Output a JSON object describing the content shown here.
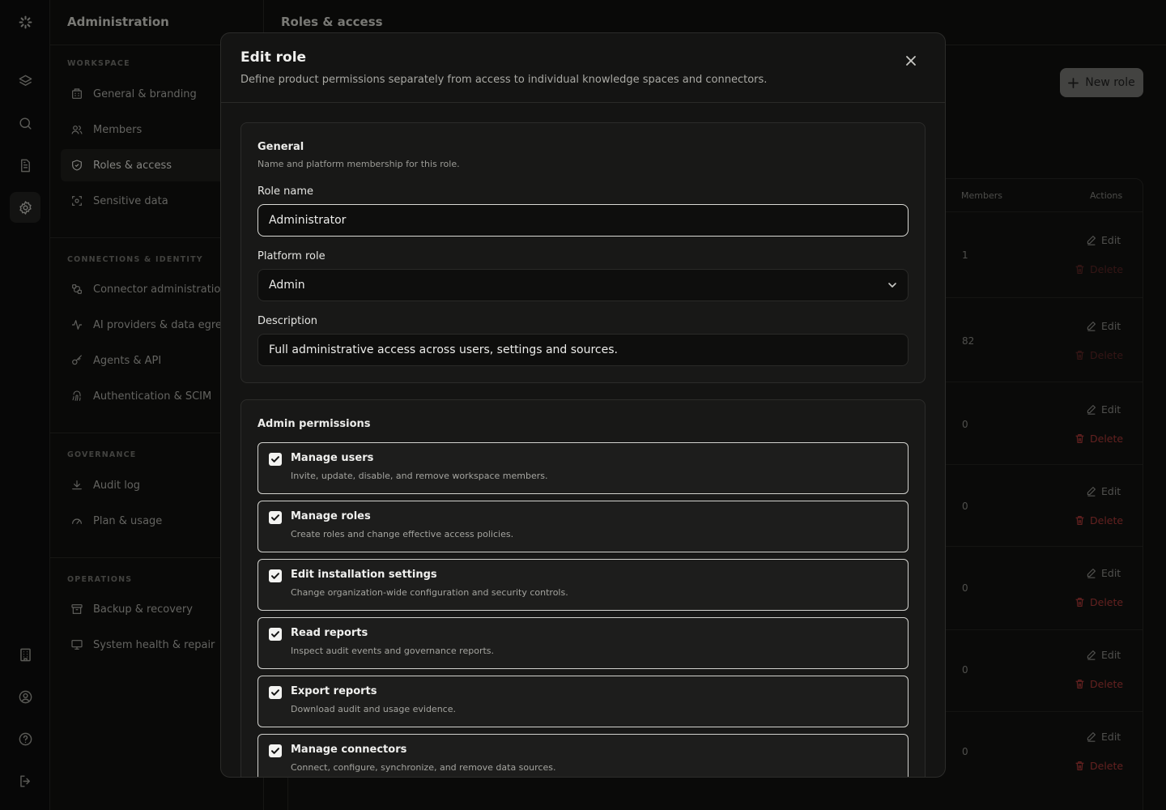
{
  "sidebar": {
    "title": "Administration",
    "sections": {
      "workspace": "WORKSPACE",
      "connections": "CONNECTIONS & IDENTITY",
      "governance": "GOVERNANCE",
      "operations": "OPERATIONS"
    },
    "items": {
      "general": "General & branding",
      "members": "Members",
      "roles": "Roles & access",
      "sensitive": "Sensitive data",
      "connector": "Connector administration",
      "ai": "AI providers & data egress",
      "agents": "Agents & API",
      "auth": "Authentication & SCIM",
      "audit": "Audit log",
      "plan": "Plan & usage",
      "backup": "Backup & recovery",
      "health": "System health & repair"
    }
  },
  "main": {
    "title": "Roles & access",
    "new_role_label": "New role",
    "columns": {
      "members": "Members",
      "actions": "Actions"
    },
    "rows": [
      {
        "members": "1",
        "edit": "Edit",
        "delete": "Delete"
      },
      {
        "members": "82",
        "edit": "Edit",
        "delete": "Delete"
      },
      {
        "members": "0",
        "edit": "Edit",
        "delete": "Delete"
      },
      {
        "members": "0",
        "edit": "Edit",
        "delete": "Delete"
      },
      {
        "members": "0",
        "edit": "Edit",
        "delete": "Delete"
      },
      {
        "members": "0",
        "edit": "Edit",
        "delete": "Delete"
      },
      {
        "members": "0",
        "edit": "Edit",
        "delete": "Delete"
      }
    ]
  },
  "modal": {
    "title": "Edit role",
    "subtitle": "Define product permissions separately from access to individual knowledge spaces and connectors.",
    "general": {
      "heading": "General",
      "subheading": "Name and platform membership for this role.",
      "role_name_label": "Role name",
      "role_name_value": "Administrator",
      "platform_role_label": "Platform role",
      "platform_role_value": "Admin",
      "description_label": "Description",
      "description_value": "Full administrative access across users, settings and sources."
    },
    "permissions": {
      "heading": "Admin permissions",
      "items": [
        {
          "title": "Manage users",
          "desc": "Invite, update, disable, and remove workspace members.",
          "checked": true
        },
        {
          "title": "Manage roles",
          "desc": "Create roles and change effective access policies.",
          "checked": true
        },
        {
          "title": "Edit installation settings",
          "desc": "Change organization-wide configuration and security controls.",
          "checked": true
        },
        {
          "title": "Read reports",
          "desc": "Inspect audit events and governance reports.",
          "checked": true
        },
        {
          "title": "Export reports",
          "desc": "Download audit and usage evidence.",
          "checked": true
        },
        {
          "title": "Manage connectors",
          "desc": "Connect, configure, synchronize, and remove data sources.",
          "checked": true
        }
      ]
    }
  }
}
